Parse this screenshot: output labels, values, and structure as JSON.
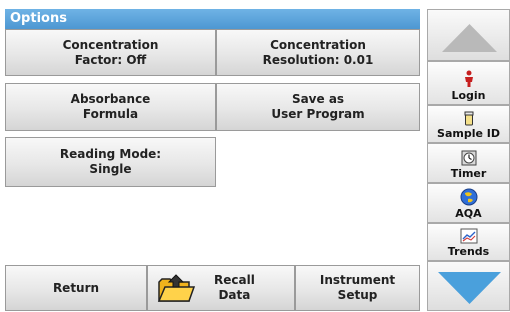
{
  "title": "Options",
  "options": [
    {
      "label": "Concentration\nFactor: Off"
    },
    {
      "label": "Concentration\nResolution: 0.01"
    },
    {
      "label": "Absorbance\nFormula"
    },
    {
      "label": "Save as\nUser Program"
    },
    {
      "label": "Reading Mode:\nSingle"
    }
  ],
  "bottom_bar": {
    "return_label": "Return",
    "recall_label": "Recall\nData",
    "setup_label": "Instrument\nSetup"
  },
  "sidebar": {
    "items": [
      {
        "label": "Login",
        "icon": "person-icon"
      },
      {
        "label": "Sample ID",
        "icon": "sample-vial-icon"
      },
      {
        "label": "Timer",
        "icon": "timer-icon"
      },
      {
        "label": "AQA",
        "icon": "aqa-globe-icon"
      },
      {
        "label": "Trends",
        "icon": "trend-chart-icon"
      }
    ]
  },
  "colors": {
    "title_bar": "#5aa6dd",
    "arrow_up": "#b9b9b9",
    "arrow_down": "#4aa0dc"
  }
}
